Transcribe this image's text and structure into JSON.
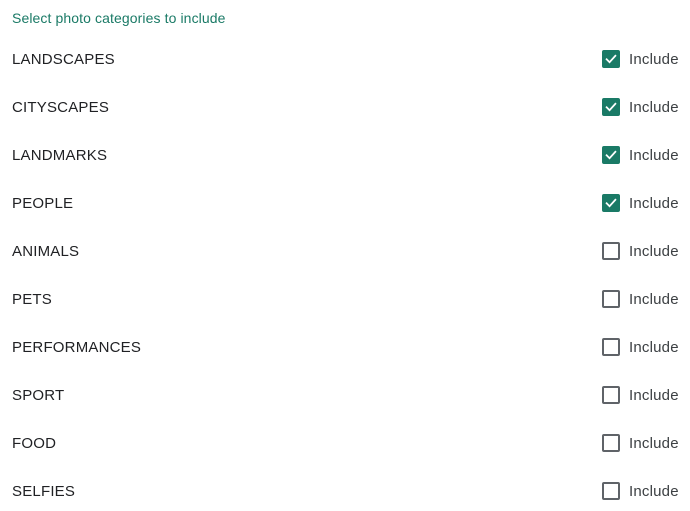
{
  "header": {
    "title": "Select photo categories to include"
  },
  "accent_color": "#1a7a66",
  "categories": [
    {
      "label": "LANDSCAPES",
      "include_label": "Include",
      "checked": true
    },
    {
      "label": "CITYSCAPES",
      "include_label": "Include",
      "checked": true
    },
    {
      "label": "LANDMARKS",
      "include_label": "Include",
      "checked": true
    },
    {
      "label": "PEOPLE",
      "include_label": "Include",
      "checked": true
    },
    {
      "label": "ANIMALS",
      "include_label": "Include",
      "checked": false
    },
    {
      "label": "PETS",
      "include_label": "Include",
      "checked": false
    },
    {
      "label": "PERFORMANCES",
      "include_label": "Include",
      "checked": false
    },
    {
      "label": "SPORT",
      "include_label": "Include",
      "checked": false
    },
    {
      "label": "FOOD",
      "include_label": "Include",
      "checked": false
    },
    {
      "label": "SELFIES",
      "include_label": "Include",
      "checked": false
    }
  ]
}
